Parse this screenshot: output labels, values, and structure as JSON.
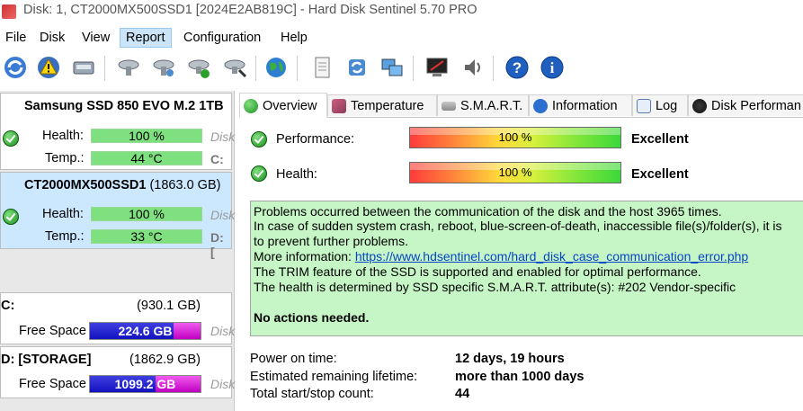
{
  "window": {
    "title": "Disk: 1, CT2000MX500SSD1 [2024E2AB819C]  -  Hard Disk Sentinel 5.70 PRO"
  },
  "menu": [
    "File",
    "Disk",
    "View",
    "Report",
    "Configuration",
    "Help"
  ],
  "active_menu": "Report",
  "disks": [
    {
      "name": "Samsung SSD 850 EVO M.2 1TB",
      "size": "",
      "health_label": "Health:",
      "health": "100 %",
      "temp_label": "Temp.:",
      "temp": "44 °C",
      "side_status": "Disk",
      "side_drive": "C:",
      "selected": false
    },
    {
      "name": "CT2000MX500SSD1",
      "size": "(1863.0 GB)",
      "health_label": "Health:",
      "health": "100 %",
      "temp_label": "Temp.:",
      "temp": "33 °C",
      "side_status": "Disk",
      "side_drive": "D: [",
      "selected": true
    }
  ],
  "volumes": [
    {
      "name": "C:",
      "size": "(930.1 GB)",
      "free_label": "Free Space",
      "free": "224.6 GB",
      "used_fraction": 0.76,
      "side": "Disk"
    },
    {
      "name": "D: [STORAGE]",
      "size": "(1862.9 GB)",
      "free_label": "Free Space",
      "free": "1099.2 GB",
      "used_fraction": 0.41,
      "side": "Disk"
    }
  ],
  "tabs": [
    "Overview",
    "Temperature",
    "S.M.A.R.T.",
    "Information",
    "Log",
    "Disk Performan"
  ],
  "overview": {
    "performance_label": "Performance:",
    "performance_value": "100 %",
    "performance_rating": "Excellent",
    "health_label": "Health:",
    "health_value": "100 %",
    "health_rating": "Excellent",
    "messages": [
      "Problems occurred between the communication of the disk and the host 3965 times.",
      "In case of sudden system crash, reboot, blue-screen-of-death, inaccessible file(s)/folder(s), it is",
      "to prevent further problems."
    ],
    "more_info_label": "More information: ",
    "more_info_link": "https://www.hdsentinel.com/hard_disk_case_communication_error.php",
    "trim_message": "The TRIM feature of the SSD is supported and enabled for optimal performance.",
    "smart_message": "The health is determined by SSD specific S.M.A.R.T. attribute(s):  #202 Vendor-specific",
    "actions": "No actions needed.",
    "stats": [
      {
        "label": "Power on time:",
        "value": "12 days, 19 hours"
      },
      {
        "label": "Estimated remaining lifetime:",
        "value": "more than 1000 days"
      },
      {
        "label": "Total start/stop count:",
        "value": "44"
      }
    ]
  },
  "colors": {
    "health_bar": "#7ee07e",
    "selected_disk": "#cce8ff",
    "message_bg": "#c6f5c6",
    "free_space_blue": "#1a1ac8",
    "used_space_pink": "#d010d0"
  }
}
